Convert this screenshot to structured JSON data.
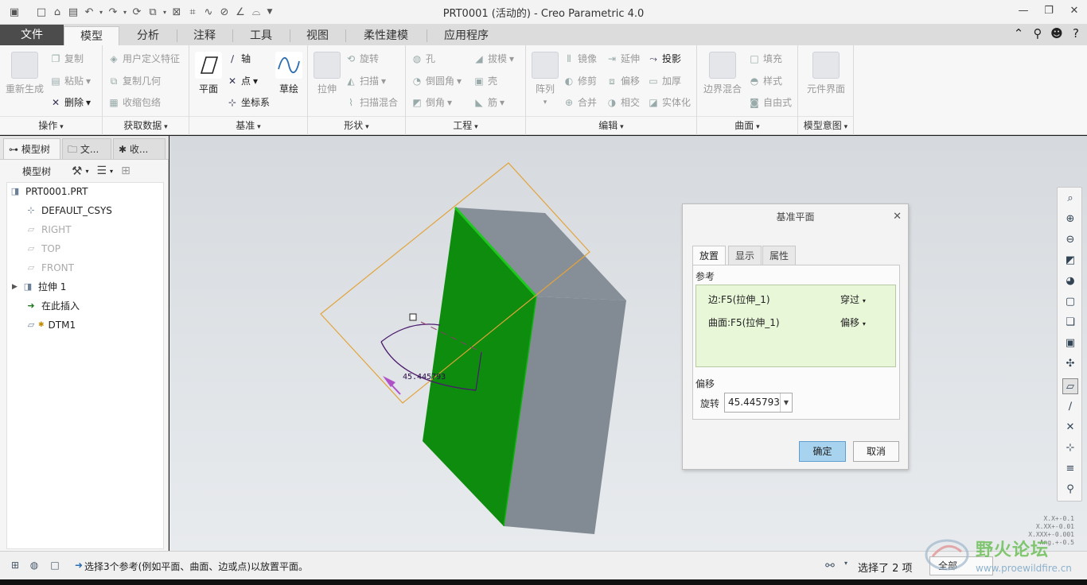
{
  "window": {
    "title": "PRT0001 (活动的) - Creo Parametric 4.0",
    "controls": [
      "—",
      "❐",
      "✕"
    ]
  },
  "ribbon_tabs": [
    "文件",
    "模型",
    "分析",
    "注释",
    "工具",
    "视图",
    "柔性建模",
    "应用程序"
  ],
  "active_tab": "模型",
  "ribbon": {
    "groups": {
      "operations": "操作",
      "get_data": "获取数据",
      "datum": "基准",
      "shapes": "形状",
      "engineering": "工程",
      "editing": "编辑",
      "surfaces": "曲面",
      "model_intent": "模型意图"
    },
    "cmds": {
      "regenerate": "重新生成",
      "copy": "复制",
      "paste": "粘贴",
      "delete": "删除",
      "udf": "用户定义特征",
      "copy_geom": "复制几何",
      "shrinkwrap": "收缩包络",
      "plane": "平面",
      "axis": "轴",
      "point": "点",
      "csys": "坐标系",
      "sketch": "草绘",
      "extrude": "拉伸",
      "revolve": "旋转",
      "sweep": "扫描",
      "swept_blend": "扫描混合",
      "hole": "孔",
      "round": "倒圆角",
      "chamfer": "倒角",
      "draft": "拔模",
      "shell": "壳",
      "rib": "筋",
      "pattern": "阵列",
      "mirror": "镜像",
      "extend": "延伸",
      "project": "投影",
      "trim": "修剪",
      "offset": "偏移",
      "thicken": "加厚",
      "merge": "合并",
      "intersect": "相交",
      "solidify": "实体化",
      "boundary_blend": "边界混合",
      "fill": "填充",
      "style": "样式",
      "freestyle": "自由式",
      "component_interface": "元件界面"
    }
  },
  "left_panel": {
    "tabs": [
      "模型树",
      "文...",
      "收..."
    ],
    "toolbar_label": "模型树",
    "tree": [
      {
        "label": "PRT0001.PRT",
        "icon": "part-icon",
        "dim": false
      },
      {
        "label": "DEFAULT_CSYS",
        "icon": "csys-icon",
        "dim": false
      },
      {
        "label": "RIGHT",
        "icon": "datum-plane-icon",
        "dim": true
      },
      {
        "label": "TOP",
        "icon": "datum-plane-icon",
        "dim": true
      },
      {
        "label": "FRONT",
        "icon": "datum-plane-icon",
        "dim": true
      },
      {
        "label": "拉伸 1",
        "icon": "extrude-icon",
        "dim": false
      },
      {
        "label": "在此插入",
        "icon": "insert-arrow-icon",
        "dim": false
      },
      {
        "label": "DTM1",
        "icon": "datum-plane-icon",
        "dim": false
      }
    ]
  },
  "viewport": {
    "dimension_label": "45.445793",
    "tolerance_text": [
      "X.X+-0.1",
      "X.XX+-0.01",
      "X.XXX+-0.001",
      "Ang.+-0.5"
    ],
    "colors": {
      "selected_face": "#0e8c0e",
      "body": "#848d96",
      "datum_plane": "#e2a33a",
      "dimension": "#4b1a6e"
    }
  },
  "dialog": {
    "title": "基准平面",
    "tabs": [
      "放置",
      "显示",
      "属性"
    ],
    "active_tab": "放置",
    "references_label": "参考",
    "references": [
      {
        "ref": "边:F5(拉伸_1)",
        "constraint": "穿过"
      },
      {
        "ref": "曲面:F5(拉伸_1)",
        "constraint": "偏移"
      }
    ],
    "offset_label": "偏移",
    "rotation_label": "旋转",
    "rotation_value": "45.445793",
    "ok": "确定",
    "cancel": "取消"
  },
  "status": {
    "message": "选择3个参考(例如平面、曲面、边或点)以放置平面。",
    "selection": "选择了 2 项",
    "filter": "全部"
  },
  "watermark": {
    "title": "野火论坛",
    "url": "www.proewildfire.cn"
  }
}
